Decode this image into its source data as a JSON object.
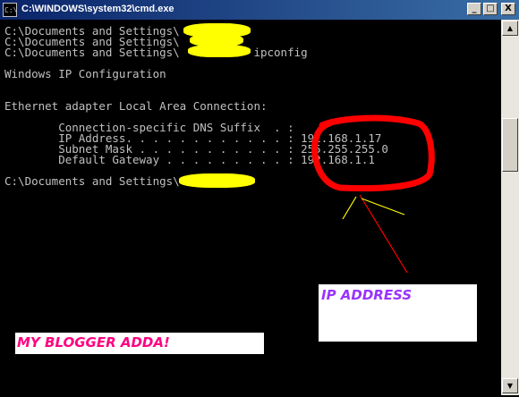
{
  "window": {
    "title": "C:\\WINDOWS\\system32\\cmd.exe",
    "buttons": {
      "minimize": "_",
      "maximize": "□",
      "close": "X"
    }
  },
  "console": {
    "lines": [
      "C:\\Documents and Settings\\",
      "C:\\Documents and Settings\\",
      "C:\\Documents and Settings\\           ipconfig",
      "",
      "Windows IP Configuration",
      "",
      "",
      "Ethernet adapter Local Area Connection:",
      "",
      "        Connection-specific DNS Suffix  . :",
      "        IP Address. . . . . . . . . . . . : 192.168.1.17",
      "        Subnet Mask . . . . . . . . . . . : 255.255.255.0",
      "        Default Gateway . . . . . . . . . : 192.168.1.1",
      "",
      "C:\\Documents and Settings\\"
    ]
  },
  "annotations": {
    "ip_label": "IP ADDRESS",
    "blog_label": "MY BLOGGER ADDA!",
    "circle_color": "#ff0000",
    "ip_label_color": "#9933ff",
    "blog_label_color": "#ff0080",
    "scribble_color": "#ffff00"
  },
  "icons": [
    "cmd-icon",
    "minimize-icon",
    "maximize-icon",
    "close-icon",
    "scroll-up-icon",
    "scroll-down-icon"
  ]
}
